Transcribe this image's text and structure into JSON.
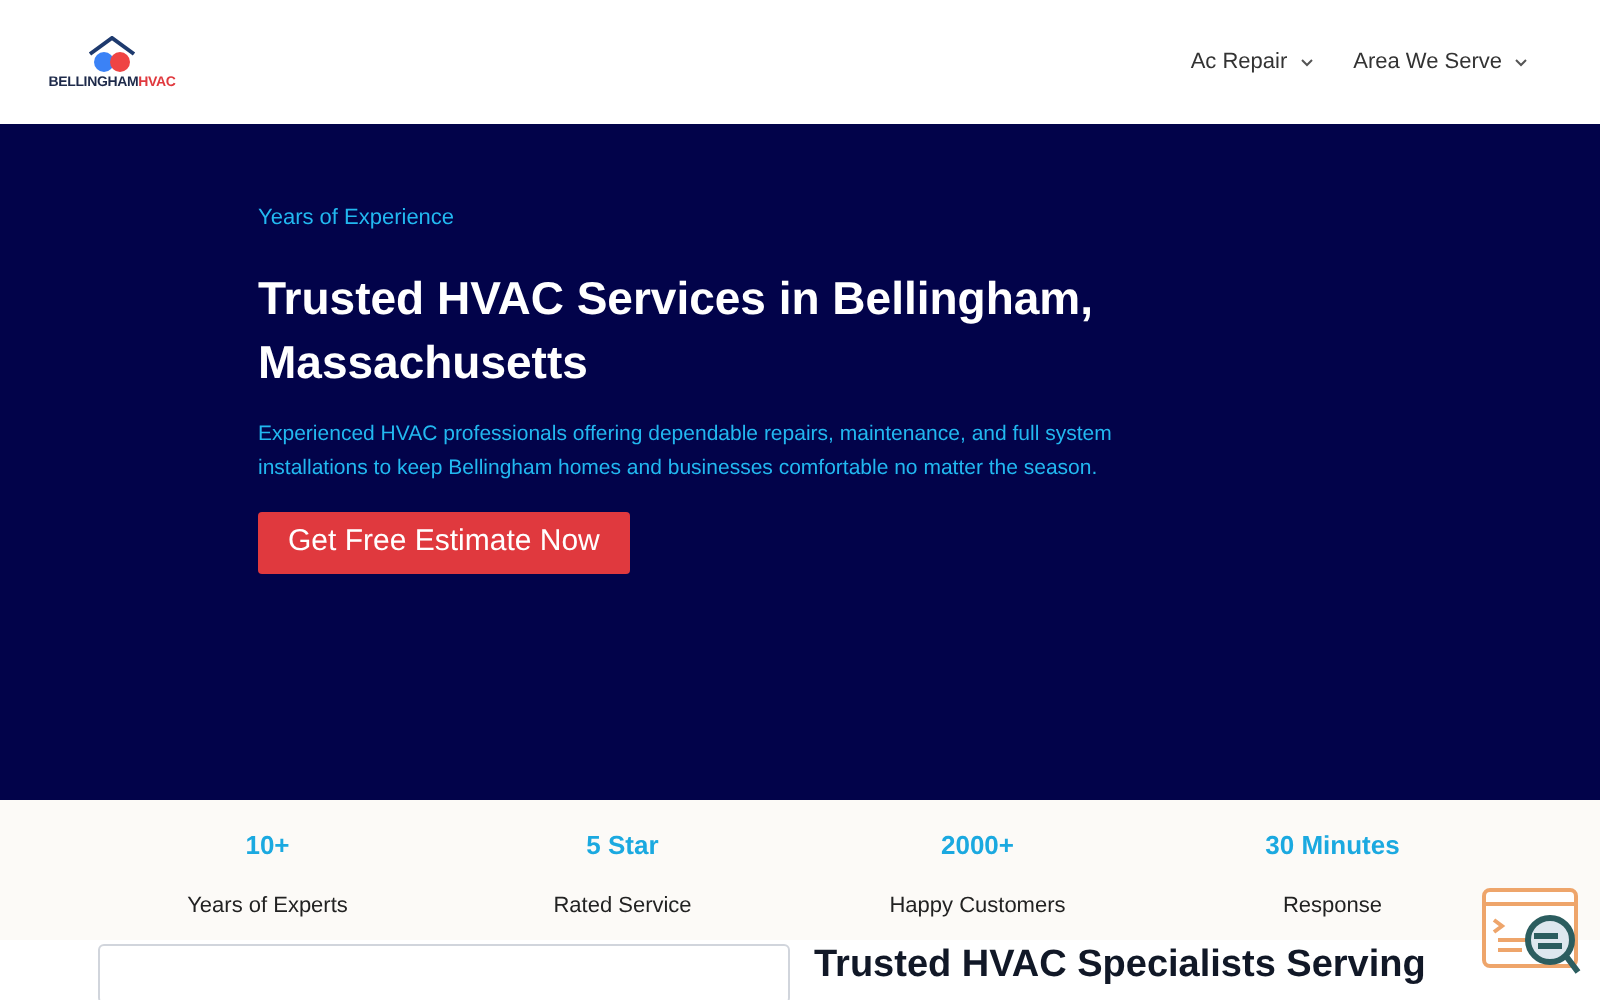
{
  "header": {
    "logo": {
      "name": "BELLINGHAM",
      "accent": "HVAC"
    },
    "nav": [
      {
        "label": "Ac Repair",
        "has_dropdown": true
      },
      {
        "label": "Area We Serve",
        "has_dropdown": true
      }
    ]
  },
  "hero": {
    "eyebrow": "Years of Experience",
    "title": "Trusted HVAC Services in Bellingham, Massachusetts",
    "text": "Experienced HVAC professionals offering dependable repairs, maintenance, and full system installations to keep Bellingham homes and businesses comfortable no matter the season.",
    "button": "Get Free Estimate Now"
  },
  "stats": [
    {
      "value": "10+",
      "label": "Years of Experts"
    },
    {
      "value": "5 Star",
      "label": "Rated Service"
    },
    {
      "value": "2000+",
      "label": "Happy Customers"
    },
    {
      "value": "30 Minutes",
      "label": "Response"
    }
  ],
  "section": {
    "heading": "Trusted HVAC Specialists Serving"
  }
}
